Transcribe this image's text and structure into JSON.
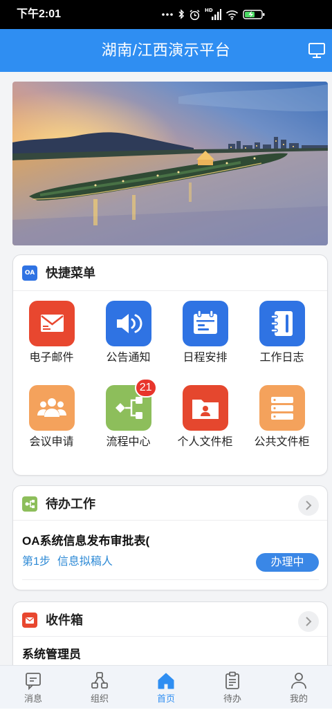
{
  "status_bar": {
    "time": "下午2:01",
    "hd_label": "HD",
    "icons": [
      "more-dots-icon",
      "bluetooth-icon",
      "alarm-icon",
      "signal-icon",
      "wifi-icon",
      "battery-charging-icon"
    ]
  },
  "header": {
    "title": "湖南/江西演示平台",
    "right_icon": "monitor-icon",
    "color": "#2f8ef2"
  },
  "banner": {
    "icon": "landscape-photo"
  },
  "quick_menu": {
    "title_icon_text": "OA",
    "title_icon_color": "#2f73e3",
    "title": "快捷菜单",
    "items": [
      {
        "label": "电子邮件",
        "icon": "mail-icon",
        "color": "#e8472f"
      },
      {
        "label": "公告通知",
        "icon": "speaker-icon",
        "color": "#2f73e3"
      },
      {
        "label": "日程安排",
        "icon": "calendar-icon",
        "color": "#2f73e3"
      },
      {
        "label": "工作日志",
        "icon": "notebook-icon",
        "color": "#2f73e3"
      },
      {
        "label": "会议申请",
        "icon": "people-icon",
        "color": "#f4a25c"
      },
      {
        "label": "流程中心",
        "icon": "flow-icon",
        "color": "#8dbe5b",
        "badge": "21"
      },
      {
        "label": "个人文件柜",
        "icon": "personal-folder-icon",
        "color": "#e5472e"
      },
      {
        "label": "公共文件柜",
        "icon": "cabinet-icon",
        "color": "#f4a25c"
      }
    ]
  },
  "pending": {
    "title": "待办工作",
    "icon": "flow-icon",
    "icon_color": "#8dbe5b",
    "items": [
      {
        "title": "OA系统信息发布审批表(",
        "step": "第1步",
        "node": "信息拟稿人",
        "status": "办理中"
      }
    ]
  },
  "inbox": {
    "title": "收件箱",
    "icon": "mail-icon",
    "icon_color": "#e8472f",
    "items": [
      {
        "sender": "系统管理员"
      }
    ]
  },
  "tabbar": {
    "active_index": 2,
    "active_color": "#2f8ef2",
    "items": [
      {
        "label": "消息",
        "icon": "message-icon"
      },
      {
        "label": "组织",
        "icon": "org-icon"
      },
      {
        "label": "首页",
        "icon": "home-icon"
      },
      {
        "label": "待办",
        "icon": "clipboard-icon"
      },
      {
        "label": "我的",
        "icon": "user-icon"
      }
    ]
  }
}
